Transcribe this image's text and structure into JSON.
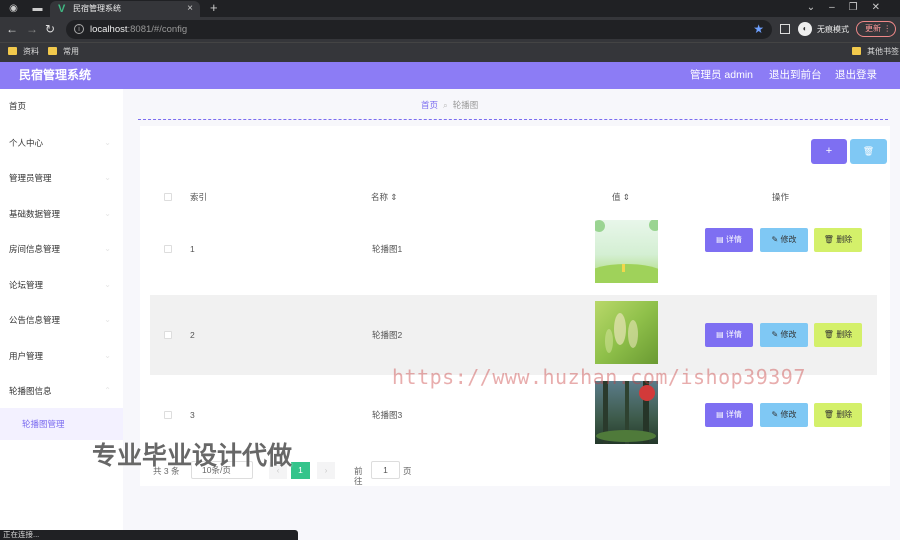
{
  "browser": {
    "tab_title": "民宿管理系统",
    "tab_logo": "V",
    "url_host": "localhost",
    "url_path": ":8081/#/config",
    "incognito_label": "无痕模式",
    "update_label": "更新",
    "bookmarks": [
      "资料",
      "常用"
    ],
    "other_bookmarks": "其他书签",
    "status_text": "正在连接..."
  },
  "header": {
    "title": "民宿管理系统",
    "user_label": "管理员 admin",
    "front_link": "退出到前台",
    "logout_link": "退出登录",
    "color": "#8c7cf5"
  },
  "sidebar": {
    "items": [
      {
        "label": "首页"
      },
      {
        "label": "个人中心"
      },
      {
        "label": "管理员管理"
      },
      {
        "label": "基础数据管理"
      },
      {
        "label": "房间信息管理"
      },
      {
        "label": "论坛管理"
      },
      {
        "label": "公告信息管理"
      },
      {
        "label": "用户管理"
      },
      {
        "label": "轮播图信息"
      }
    ],
    "active_sub": "轮播图管理"
  },
  "breadcrumb": {
    "home": "首页",
    "current": "轮播图"
  },
  "toolbar": {
    "add_icon": "+",
    "delete_icon": "🗑"
  },
  "table": {
    "columns": [
      "索引",
      "名称 ⇕",
      "值 ⇕",
      "操作"
    ],
    "rows": [
      {
        "index": "1",
        "name": "轮播图1",
        "image": "meadow-image"
      },
      {
        "index": "2",
        "name": "轮播图2",
        "image": "green-blur-image"
      },
      {
        "index": "3",
        "name": "轮播图3",
        "image": "forest-image"
      }
    ],
    "actions": {
      "detail": "详情",
      "edit": "修改",
      "remove": "删除"
    }
  },
  "pagination": {
    "total": "共 3 条",
    "page_size": "10条/页",
    "current_page": "1",
    "goto_label": "前往",
    "goto_value": "1",
    "page_unit": "页"
  },
  "watermarks": {
    "url": "https://www.huzhan.com/ishop39397",
    "cn": "专业毕业设计代做"
  },
  "colors": {
    "accent": "#7e6ff2",
    "edit": "#7fc8f4",
    "remove": "#d4f06a",
    "page_active": "#34c48b"
  }
}
